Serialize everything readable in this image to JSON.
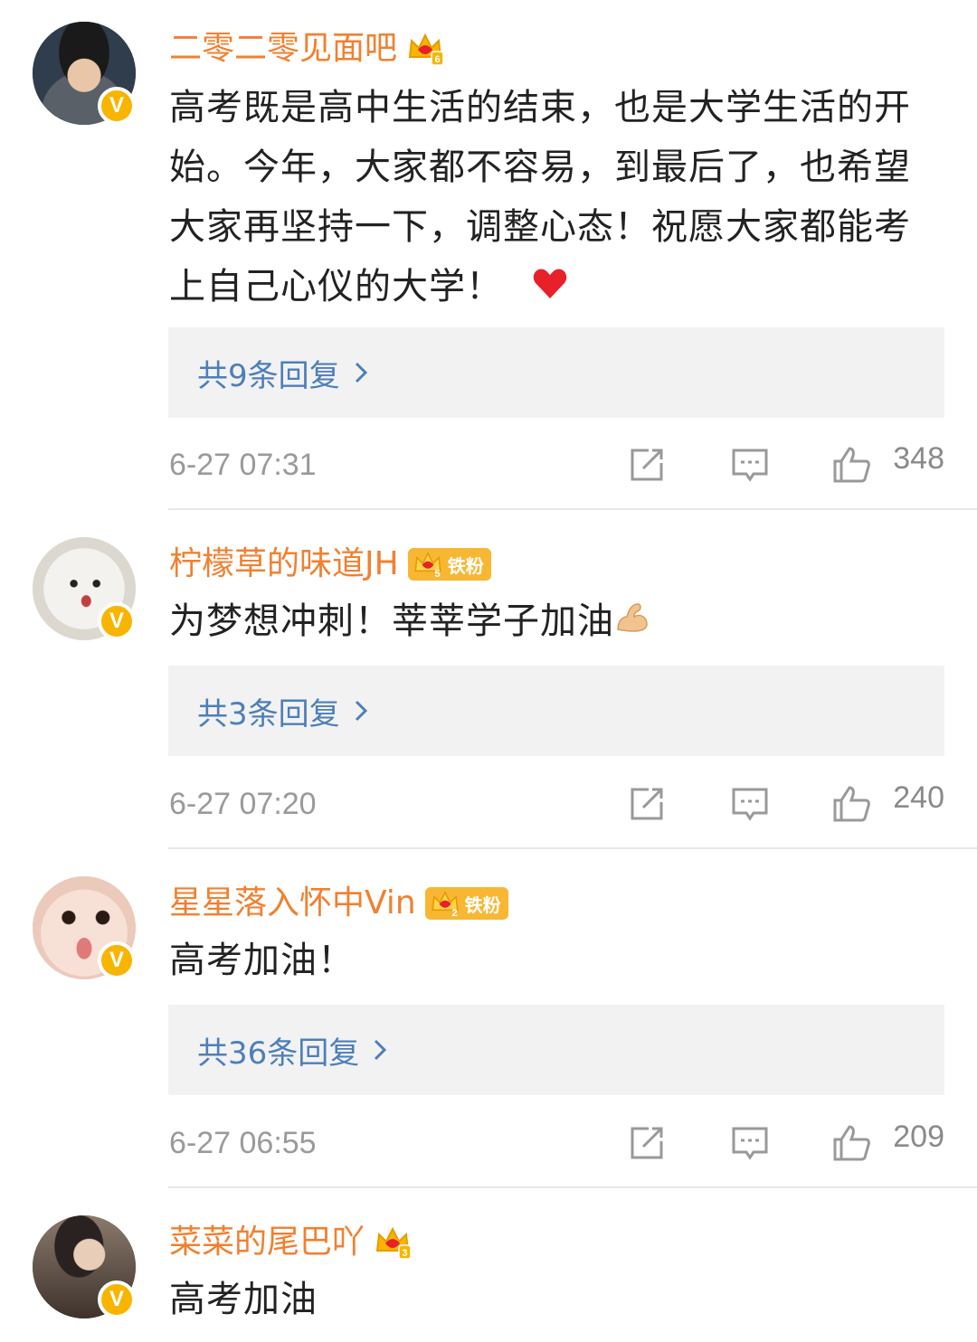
{
  "comments": [
    {
      "username": "二零二零见面吧",
      "crown_level": "6",
      "fan_badge": "",
      "text": "高考既是高中生活的结束，也是大学生活的开始。今年，大家都不容易，到最后了，也希望大家再坚持一下，调整心态！祝愿大家都能考上自己心仪的大学！",
      "emoji": "❤️",
      "replies_label": "共9条回复",
      "timestamp": "6-27 07:31",
      "likes": "348"
    },
    {
      "username": "柠檬草的味道JH",
      "crown_level": "5",
      "fan_badge": "铁粉",
      "text": "为梦想冲刺！莘莘学子加油",
      "emoji": "💪",
      "replies_label": "共3条回复",
      "timestamp": "6-27 07:20",
      "likes": "240"
    },
    {
      "username": "星星落入怀中Vin",
      "crown_level": "2",
      "fan_badge": "铁粉",
      "text": "高考加油！",
      "emoji": "",
      "replies_label": "共36条回复",
      "timestamp": "6-27 06:55",
      "likes": "209"
    },
    {
      "username": "菜菜的尾巴吖",
      "crown_level": "3",
      "fan_badge": "",
      "text": "高考加油",
      "emoji": ""
    }
  ],
  "icons": {
    "verified": "verified-v-icon",
    "repost": "repost-icon",
    "comment": "comment-icon",
    "like": "thumbs-up-icon",
    "chevron": "chevron-right-icon",
    "crown": "crown-level-icon"
  },
  "colors": {
    "username": "#f08030",
    "reply_link": "#4d7fb8",
    "verified": "#f7b500",
    "fan_badge": "#f7b733",
    "heart": "#e8202a"
  }
}
